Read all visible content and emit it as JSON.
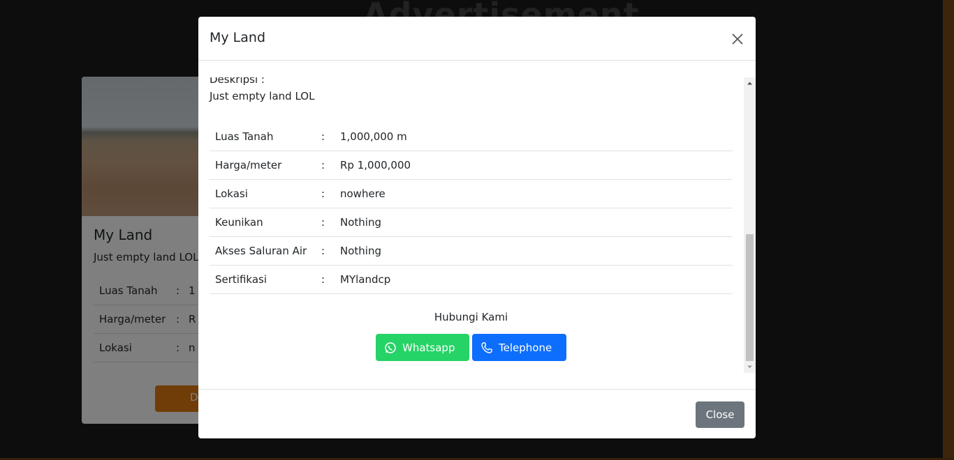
{
  "background": {
    "heading": "Advertisement",
    "card": {
      "title": "My Land",
      "description": "Just empty land LOL",
      "rows": [
        {
          "key": "Luas Tanah",
          "colon": ":",
          "value": "1"
        },
        {
          "key": "Harga/meter",
          "colon": ":",
          "value": "R"
        },
        {
          "key": "Lokasi",
          "colon": ":",
          "value": "n"
        }
      ],
      "button_label": "D"
    }
  },
  "modal": {
    "title": "My Land",
    "close_icon": "close-icon",
    "description_label": "Deskripsi :",
    "description_text": "Just empty land LOL",
    "specs": [
      {
        "key": "Luas Tanah",
        "colon": ":",
        "value": "1,000,000 m"
      },
      {
        "key": "Harga/meter",
        "colon": ":",
        "value": "Rp 1,000,000"
      },
      {
        "key": "Lokasi",
        "colon": ":",
        "value": "nowhere"
      },
      {
        "key": "Keunikan",
        "colon": ":",
        "value": "Nothing"
      },
      {
        "key": "Akses Saluran Air",
        "colon": ":",
        "value": "Nothing"
      },
      {
        "key": "Sertifikasi",
        "colon": ":",
        "value": "MYlandcp"
      }
    ],
    "contact_title": "Hubungi Kami",
    "whatsapp_label": "Whatsapp",
    "telephone_label": "Telephone",
    "footer_close_label": "Close"
  },
  "colors": {
    "whatsapp": "#25d366",
    "telephone": "#0d6efd",
    "close_button": "#6c757d",
    "accent": "#e07b10"
  }
}
